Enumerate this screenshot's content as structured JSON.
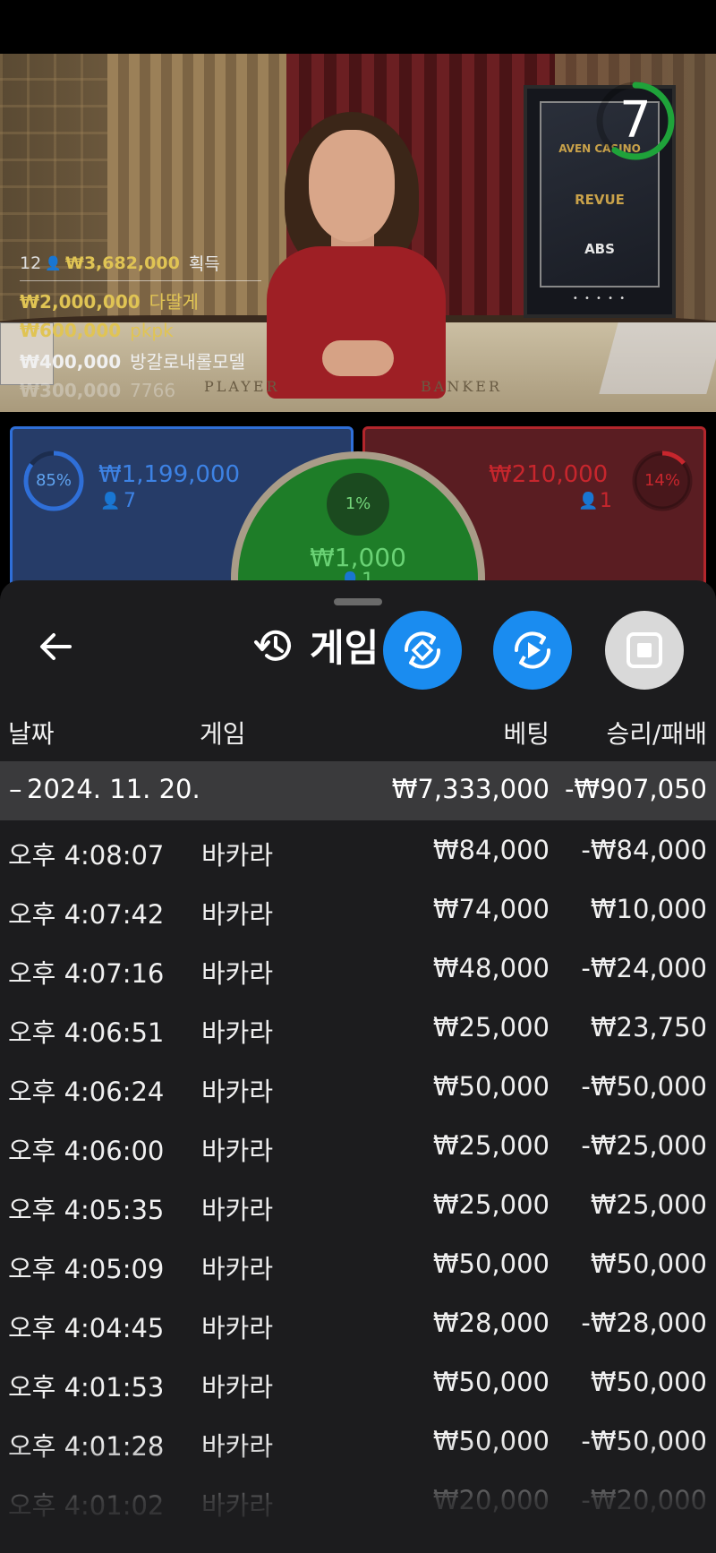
{
  "video": {
    "table_labels": [
      "PLAYER",
      "BANKER"
    ],
    "sign_logos": [
      "AVEN CASINO",
      "REVUE",
      "ABS"
    ],
    "timer_value": "7",
    "timer_color": "#1fa33a"
  },
  "winners": {
    "count": "12",
    "total": "₩3,682,000",
    "suffix": "획득",
    "list": [
      {
        "amount": "₩2,000,000",
        "name": "다딸게",
        "style": "gold"
      },
      {
        "amount": "₩600,000",
        "name": "pkpk",
        "style": "gold"
      },
      {
        "amount": "₩400,000",
        "name": "방갈로내롤모델",
        "style": "white"
      },
      {
        "amount": "₩300,000",
        "name": "7766",
        "style": "fade"
      }
    ]
  },
  "bets": {
    "player": {
      "pct": "85%",
      "pct_value": 0.85,
      "amount": "₩1,199,000",
      "count": "7",
      "color": "#2f6fd8"
    },
    "banker": {
      "pct": "14%",
      "pct_value": 0.14,
      "amount": "₩210,000",
      "count": "1",
      "color": "#c7262d"
    },
    "tie": {
      "pct": "1%",
      "amount": "₩1,000",
      "count": "1",
      "color": "#1e7d28"
    }
  },
  "sheet": {
    "back_icon": "arrow-left-icon",
    "history_icon": "history-icon",
    "title": "게임",
    "fab_icons": [
      "rotate-cast-icon",
      "replay-icon",
      "stop-icon"
    ],
    "columns": [
      "날짜",
      "게임",
      "베팅",
      "승리/패배"
    ],
    "date_group": {
      "toggle": "–",
      "date": "2024. 11. 20.",
      "bet_total": "₩7,333,000",
      "result_total": "-₩907,050"
    },
    "rows": [
      {
        "time": "오후 4:08:07",
        "game": "바카라",
        "bet": "₩84,000",
        "result": "-₩84,000"
      },
      {
        "time": "오후 4:07:42",
        "game": "바카라",
        "bet": "₩74,000",
        "result": "₩10,000"
      },
      {
        "time": "오후 4:07:16",
        "game": "바카라",
        "bet": "₩48,000",
        "result": "-₩24,000"
      },
      {
        "time": "오후 4:06:51",
        "game": "바카라",
        "bet": "₩25,000",
        "result": "₩23,750"
      },
      {
        "time": "오후 4:06:24",
        "game": "바카라",
        "bet": "₩50,000",
        "result": "-₩50,000"
      },
      {
        "time": "오후 4:06:00",
        "game": "바카라",
        "bet": "₩25,000",
        "result": "-₩25,000"
      },
      {
        "time": "오후 4:05:35",
        "game": "바카라",
        "bet": "₩25,000",
        "result": "₩25,000"
      },
      {
        "time": "오후 4:05:09",
        "game": "바카라",
        "bet": "₩50,000",
        "result": "₩50,000"
      },
      {
        "time": "오후 4:04:45",
        "game": "바카라",
        "bet": "₩28,000",
        "result": "-₩28,000"
      },
      {
        "time": "오후 4:01:53",
        "game": "바카라",
        "bet": "₩50,000",
        "result": "₩50,000"
      },
      {
        "time": "오후 4:01:28",
        "game": "바카라",
        "bet": "₩50,000",
        "result": "-₩50,000"
      },
      {
        "time": "오후 4:01:02",
        "game": "바카라",
        "bet": "₩20,000",
        "result": "-₩20,000"
      }
    ]
  }
}
